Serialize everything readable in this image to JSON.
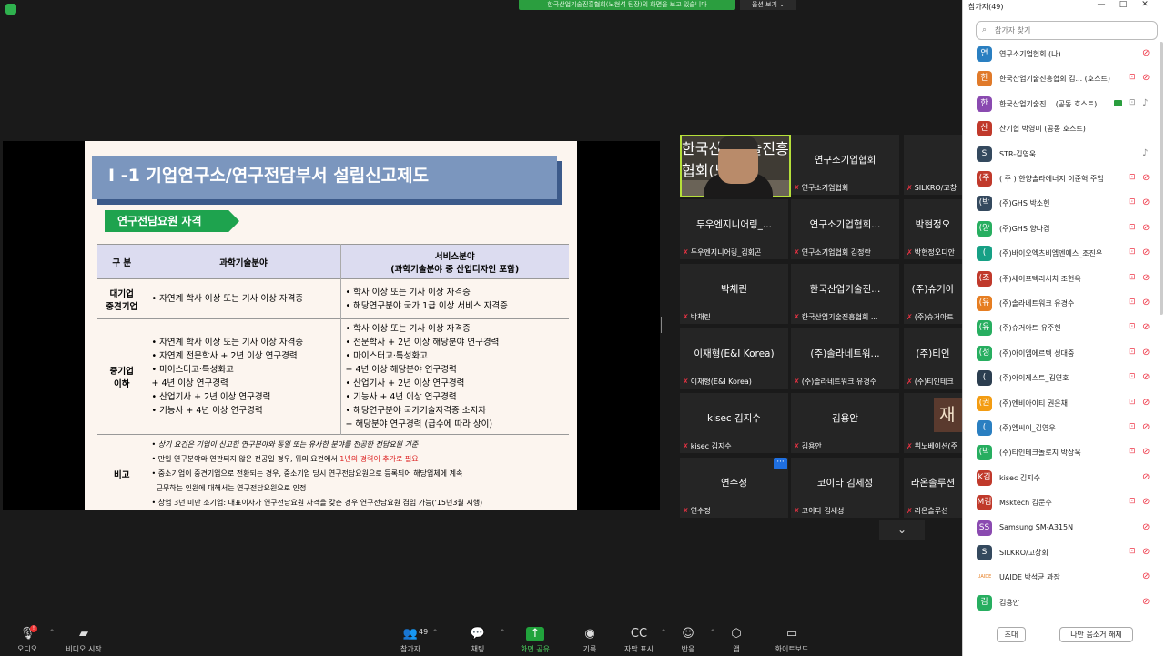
{
  "banner": {
    "text": "한국산업기술진흥협회(노현석 팀장)의 화면을 보고 있습니다",
    "view_options": "옵션 보기 ⌄"
  },
  "slide": {
    "title": "I -1 기업연구소/연구전담부서 설립신고제도",
    "subtitle": "연구전담요원 자격",
    "headers": [
      "구 분",
      "과학기술분야",
      "서비스분야\n(과학기술분야 중 산업디자인 포함)"
    ],
    "rows": [
      {
        "category": "대기업\n중견기업",
        "sci": "• 자연계 학사 이상 또는 기사 이상 자격증",
        "svc": "• 학사 이상 또는 기사 이상 자격증\n• 해당연구분야 국가 1급 이상 서비스 자격증"
      },
      {
        "category": "중기업\n이하",
        "sci": "• 자연계 학사 이상 또는 기사 이상 자격증\n• 자연계 전문학사 + 2년 이상 연구경력\n• 마이스터고·특성화고\n   + 4년 이상 연구경력\n• 산업기사 + 2년 이상 연구경력\n• 기능사 + 4년 이상 연구경력",
        "svc": "• 학사 이상 또는 기사 이상 자격증\n• 전문학사 + 2년 이상 해당분야 연구경력\n• 마이스터고·특성화고\n   + 4년 이상 해당분야 연구경력\n• 산업기사 + 2년 이상 연구경력\n• 기능사 + 4년 이상 연구경력\n• 해당연구분야 국가기술자격증 소지자\n   + 해당분야 연구경력 (급수에 따라 상이)"
      }
    ],
    "note_category": "비고",
    "notes": {
      "n1": "• 상기 요건은 기업이 신고한 연구분야와 동일 또는 유사한 분야를 전공한 전담요원 기준",
      "n2a": "• 만일 연구분야와 연관되지 않은 전공일 경우, 위의 요건에서 ",
      "n2b": "1년의 경력이 추가로 필요",
      "n3": "• 중소기업이 중견기업으로 전환되는 경우, 중소기업 당시 연구전담요원으로 등록되어 해당업체에 계속",
      "n4": "  근무하는 인원에 대해서는 연구전담요원으로 인정",
      "n5": "• 창업 3년 미만 소기업: 대표이사가 연구전담요원 자격을 갖춘 경우 연구전담요원 겸임 가능('15년3월 시행)"
    }
  },
  "tiles": [
    {
      "big": "",
      "small": "한국산업기술진흥협회(노현..."
    },
    {
      "big": "연구소기업협회",
      "small": "연구소기업협회"
    },
    {
      "big": "",
      "small": "SILKRO/고창"
    },
    {
      "big": "두우엔지니어링_...",
      "small": "두우엔지니어링_김회곤"
    },
    {
      "big": "연구소기업협회...",
      "small": "연구소기업협회 김정란"
    },
    {
      "big": "박현정오",
      "small": "박현정오디안"
    },
    {
      "big": "박채린",
      "small": "박채린"
    },
    {
      "big": "한국산업기술진...",
      "small": "한국산업기술진흥협회 ..."
    },
    {
      "big": "(주)슈거아",
      "small": "(주)슈거아트"
    },
    {
      "big": "이재형(E&I Korea)",
      "small": "이재형(E&I Korea)"
    },
    {
      "big": "(주)솔라네트워...",
      "small": "(주)솔라네트워크 유경수"
    },
    {
      "big": "(주)티인",
      "small": "(주)티인테크"
    },
    {
      "big": "kisec 김지수",
      "small": "kisec 김지수"
    },
    {
      "big": "김용안",
      "small": "김용안"
    },
    {
      "big": "",
      "small": "위노베이션(주"
    },
    {
      "big": "연수정",
      "small": "연수정"
    },
    {
      "big": "코이타 김세성",
      "small": "코이타 김세성"
    },
    {
      "big": "라온솔루션",
      "small": "라온솔루션"
    }
  ],
  "jae_thumb": "재",
  "toolbar": [
    {
      "label": "오디오",
      "icon": "mic-icon",
      "glyph": "🎙"
    },
    {
      "label": "비디오 시작",
      "icon": "video-off-icon",
      "glyph": "▰"
    },
    {
      "label": "참가자",
      "icon": "participants-icon",
      "glyph": "👥",
      "count": "49"
    },
    {
      "label": "채팅",
      "icon": "chat-icon",
      "glyph": "💬"
    },
    {
      "label": "화면 공유",
      "icon": "share-screen-icon",
      "glyph": "↑"
    },
    {
      "label": "기록",
      "icon": "record-icon",
      "glyph": "◉"
    },
    {
      "label": "자막 표시",
      "icon": "cc-icon",
      "glyph": "CC"
    },
    {
      "label": "반응",
      "icon": "reaction-icon",
      "glyph": "☺"
    },
    {
      "label": "앱",
      "icon": "apps-icon",
      "glyph": "⬡"
    },
    {
      "label": "화이트보드",
      "icon": "whiteboard-icon",
      "glyph": "▭"
    }
  ],
  "mic_badge": "!",
  "panel": {
    "title": "참가자(49)",
    "search_placeholder": "참가자 찾기",
    "invite": "초대",
    "unmute": "나만 음소거 해제",
    "participants": [
      {
        "av": "연",
        "color": "#2a7fc1",
        "name": "연구소기업협회 (나)",
        "muted": true,
        "video": false
      },
      {
        "av": "한",
        "color": "#e07a2a",
        "name": "한국산업기술진흥협회 김... (호스트)",
        "muted": true,
        "video": true
      },
      {
        "av": "한",
        "color": "#8a4ab0",
        "name": "한국산업기술진... (공동 호스트)",
        "muted": false,
        "video": "on",
        "badge": true
      },
      {
        "av": "산",
        "color": "#c0392b",
        "name": "산기협 박영미 (공동 호스트)",
        "muted": null,
        "video": null
      },
      {
        "av": "S",
        "color": "#34495e",
        "name": "STR-김영욱",
        "muted": false,
        "video": null
      },
      {
        "av": "(주",
        "color": "#c0392b",
        "name": "( 주 ) 한양솔라에너지 이준혁 주임",
        "muted": true,
        "video": true
      },
      {
        "av": "(박",
        "color": "#34495e",
        "name": "(주)GHS 박소현",
        "muted": true,
        "video": true
      },
      {
        "av": "(양",
        "color": "#27ae60",
        "name": "(주)GHS 양나겸",
        "muted": true,
        "video": true
      },
      {
        "av": "(",
        "color": "#16a085",
        "name": "(주)바이오엑츠비엠엔에스_조진우",
        "muted": true,
        "video": true
      },
      {
        "av": "(조",
        "color": "#c0392b",
        "name": "(주)세이프텍리서치 조현옥",
        "muted": true,
        "video": true
      },
      {
        "av": "(유",
        "color": "#e67e22",
        "name": "(주)솔라네트워크 유경수",
        "muted": true,
        "video": true
      },
      {
        "av": "(유",
        "color": "#27ae60",
        "name": "(주)슈거아트 유주현",
        "muted": true,
        "video": true
      },
      {
        "av": "(성",
        "color": "#27ae60",
        "name": "(주)아이엠에르텍 성대중",
        "muted": true,
        "video": true
      },
      {
        "av": "(",
        "color": "#2c3e50",
        "name": "(주)아이제스트_김연호",
        "muted": true,
        "video": true
      },
      {
        "av": "(권",
        "color": "#f39c12",
        "name": "(주)엔비아이티 권은채",
        "muted": true,
        "video": true
      },
      {
        "av": "(",
        "color": "#2a7fc1",
        "name": "(주)엠씨이_김영우",
        "muted": true,
        "video": true
      },
      {
        "av": "(박",
        "color": "#27ae60",
        "name": "(주)티인테크놀로지 박상욱",
        "muted": true,
        "video": true
      },
      {
        "av": "K김",
        "color": "#c0392b",
        "name": "kisec 김지수",
        "muted": true,
        "video": null
      },
      {
        "av": "M김",
        "color": "#c0392b",
        "name": "Msktech 김문수",
        "muted": true,
        "video": true
      },
      {
        "av": "SS",
        "color": "#8a4ab0",
        "name": "Samsung SM-A315N",
        "muted": true,
        "video": null
      },
      {
        "av": "S",
        "color": "#34495e",
        "name": "SILKRO/고창회",
        "muted": true,
        "video": true
      },
      {
        "av": "UAIDE",
        "color": "#ffffff",
        "name": "UAIDE 박석균 과장",
        "muted": true,
        "video": null
      },
      {
        "av": "김",
        "color": "#27ae60",
        "name": "김용안",
        "muted": true,
        "video": null
      }
    ]
  }
}
